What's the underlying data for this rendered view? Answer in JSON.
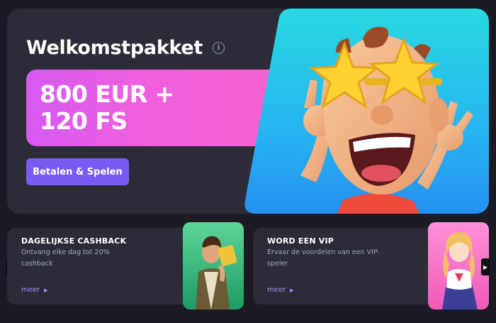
{
  "hero": {
    "title": "Welkomstpakket",
    "info_icon": "info-icon",
    "offer_line1": "800 EUR +",
    "offer_line2": "120 FS",
    "cta_label": "Betalen & Spelen",
    "illustration": "cartoon-man-star-glasses"
  },
  "promos": [
    {
      "title": "DAGELIJKSE CASHBACK",
      "description": "Ontvang elke dag tot 20% cashback",
      "more_label": "meer",
      "illustration": "adventurer-with-golden-book"
    },
    {
      "title": "WORD EEN VIP",
      "description": "Ervaar de voordelen van een VIP-speler",
      "more_label": "meer",
      "illustration": "anime-girl"
    }
  ],
  "nav": {
    "prev_icon": "chevron-left-icon",
    "next_icon": "chevron-right-icon"
  },
  "colors": {
    "background": "#1a1b23",
    "card": "#2b2c37",
    "offer_gradient_start": "#d659f2",
    "offer_gradient_end": "#fb62cb",
    "cta": "#7a5af5",
    "link": "#b58cff"
  }
}
